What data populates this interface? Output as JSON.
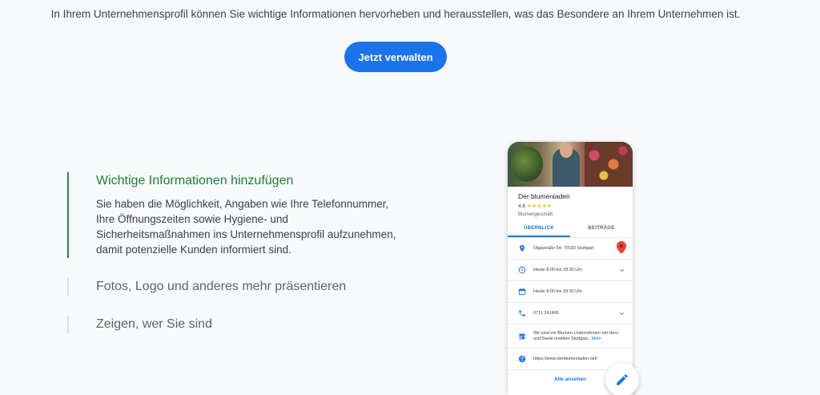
{
  "intro_text": "In Ihrem Unternehmensprofil können Sie wichtige Informationen hervorheben und herausstellen, was das Besondere an Ihrem Unternehmen ist.",
  "cta_label": "Jetzt verwalten",
  "accordion": [
    {
      "title": "Wichtige Informationen hinzufügen",
      "body": "Sie haben die Möglichkeit, Angaben wie Ihre Telefonnummer, Ihre Öffnungszeiten sowie Hygiene- und Sicherheitsmaßnahmen ins Unternehmensprofil aufzunehmen, damit potenzielle Kunden informiert sind.",
      "active": true
    },
    {
      "title": "Fotos, Logo und anderes mehr präsentieren",
      "active": false
    },
    {
      "title": "Zeigen, wer Sie sind",
      "active": false
    }
  ],
  "phone": {
    "business_name": "Der blumenladen",
    "rating": "4.6",
    "stars": "★★★★★",
    "category": "Blumengeschäft",
    "tabs": [
      "ÜBERBLICK",
      "BEITRÄGE"
    ],
    "active_tab": "ÜBERBLICK",
    "rows": {
      "address": "Olgastraße 54, 70182 Stuttgart",
      "hours1": "Heute 8:00 bis 18:30 Uhr",
      "hours2": "Heute 8:00 bis 18:30 Uhr",
      "phone": "0711 241466",
      "description": "Wir sind ein Blumen-Unternehmen mit Herz und Seele inmitten Stuttgart...",
      "description_more": "Mehr",
      "website": "https://www.derblumenladen.net/"
    },
    "see_all": "Alle ansehen"
  },
  "colors": {
    "accent": "#1a73e8",
    "active_green": "#188038",
    "star": "#fbbc04",
    "pin": "#ea4335"
  },
  "icons": [
    "location-icon",
    "clock-icon",
    "calendar-icon",
    "phone-icon",
    "store-icon",
    "globe-icon",
    "map-pin-icon",
    "edit-pencil-icon"
  ]
}
